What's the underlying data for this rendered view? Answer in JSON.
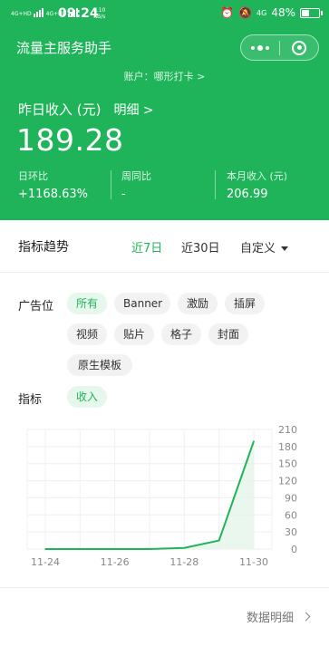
{
  "status_bar": {
    "signal_tags": [
      "4G+HD",
      "4G+HD"
    ],
    "time": "09:24",
    "speed_value": "2.10",
    "speed_unit": "KB/s",
    "network": "4G",
    "battery_percent": "48%",
    "battery_level": 0.48
  },
  "header": {
    "app_title": "流量主服务助手",
    "account_label": "账户：",
    "account_name": "哪形打卡",
    "account_chevron": ">",
    "yesterday_label": "昨日收入 (元)",
    "detail_link": "明细 >",
    "yesterday_value": "189.28",
    "stats": [
      {
        "label": "日环比",
        "value": "+1168.63%"
      },
      {
        "label": "周同比",
        "value": "-"
      },
      {
        "label": "本月收入 (元)",
        "value": "206.99"
      }
    ]
  },
  "trend": {
    "title": "指标趋势",
    "ranges": [
      "近7日",
      "近30日",
      "自定义"
    ],
    "active_range": "近7日"
  },
  "filters": {
    "ad_slot_label": "广告位",
    "ad_slots": [
      "所有",
      "Banner",
      "激励",
      "插屏",
      "视频",
      "贴片",
      "格子",
      "封面",
      "原生模板"
    ],
    "active_slot": "所有",
    "metric_label": "指标",
    "metrics": [
      "收入"
    ],
    "active_metric": "收入"
  },
  "chart_data": {
    "type": "area",
    "x": [
      "11-24",
      "11-25",
      "11-26",
      "11-27",
      "11-28",
      "11-29",
      "11-30"
    ],
    "x_tick_labels": [
      "11-24",
      "11-26",
      "11-28",
      "11-30"
    ],
    "series": [
      {
        "values": [
          0,
          0,
          0,
          0,
          2,
          15,
          189.28
        ]
      }
    ],
    "y_ticks": [
      0,
      30,
      60,
      90,
      120,
      150,
      180,
      210
    ],
    "ylim": [
      0,
      210
    ],
    "grid": true,
    "y_axis_position": "right",
    "colors": {
      "line": "#1fb45a",
      "fill": "#e3f5ea"
    }
  },
  "footer": {
    "data_detail_label": "数据明细"
  },
  "colors": {
    "brand_green": "#1fb45a",
    "chip_bg": "#f2f2f2",
    "chip_active_bg": "#e6f7ec"
  }
}
